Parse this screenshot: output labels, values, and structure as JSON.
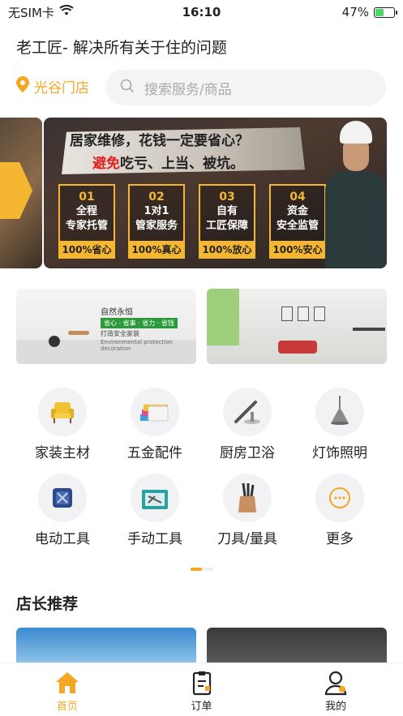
{
  "status_bar": {
    "carrier": "无SIM卡",
    "time": "16:10",
    "battery_percent": "47%",
    "battery_level": 0.47,
    "icons": [
      "wifi-icon",
      "battery-icon"
    ]
  },
  "header": {
    "title": "老工匠- 解决所有关于住的问题"
  },
  "store": {
    "name": "光谷门店",
    "icon": "location-pin-icon"
  },
  "search": {
    "placeholder": "搜索服务/商品",
    "icon": "search-icon"
  },
  "banner": {
    "headline": "居家维修，花钱一定要省心？",
    "headline2_red": "避免",
    "headline2_rest": "吃亏、上当、被坑。",
    "features": [
      {
        "num": "01",
        "line1": "全程",
        "line2": "专家托管",
        "pct": "100%省心"
      },
      {
        "num": "02",
        "line1": "1对1",
        "line2": "管家服务",
        "pct": "100%真心"
      },
      {
        "num": "03",
        "line1": "自有",
        "line2": "工匠保障",
        "pct": "100%放心"
      },
      {
        "num": "04",
        "line1": "资金",
        "line2": "安全监管",
        "pct": "100%安心"
      }
    ]
  },
  "promos": {
    "left": {
      "slogan": "自然永恒",
      "tags": "省心 · 省事 · 省力 · 省钱",
      "sub": "打造安全家装",
      "sub2": "Environmental protection decoration"
    }
  },
  "categories": [
    {
      "label": "家装主材",
      "icon": "armchair-icon"
    },
    {
      "label": "五金配件",
      "icon": "tape-rolls-icon"
    },
    {
      "label": "厨房卫浴",
      "icon": "faucet-icon"
    },
    {
      "label": "灯饰照明",
      "icon": "pendant-lamp-icon"
    },
    {
      "label": "电动工具",
      "icon": "power-tool-icon"
    },
    {
      "label": "手动工具",
      "icon": "toolbox-icon"
    },
    {
      "label": "刀具/量具",
      "icon": "knife-block-icon"
    },
    {
      "label": "更多",
      "icon": "more-icon"
    }
  ],
  "section": {
    "title": "店长推荐"
  },
  "tab_bar": {
    "tabs": [
      {
        "label": "首页",
        "icon": "home-icon",
        "active": true
      },
      {
        "label": "订单",
        "icon": "clipboard-icon",
        "active": false
      },
      {
        "label": "我的",
        "icon": "user-icon",
        "active": false
      }
    ]
  },
  "colors": {
    "accent": "#f5a623",
    "highlight_red": "#e02020"
  }
}
